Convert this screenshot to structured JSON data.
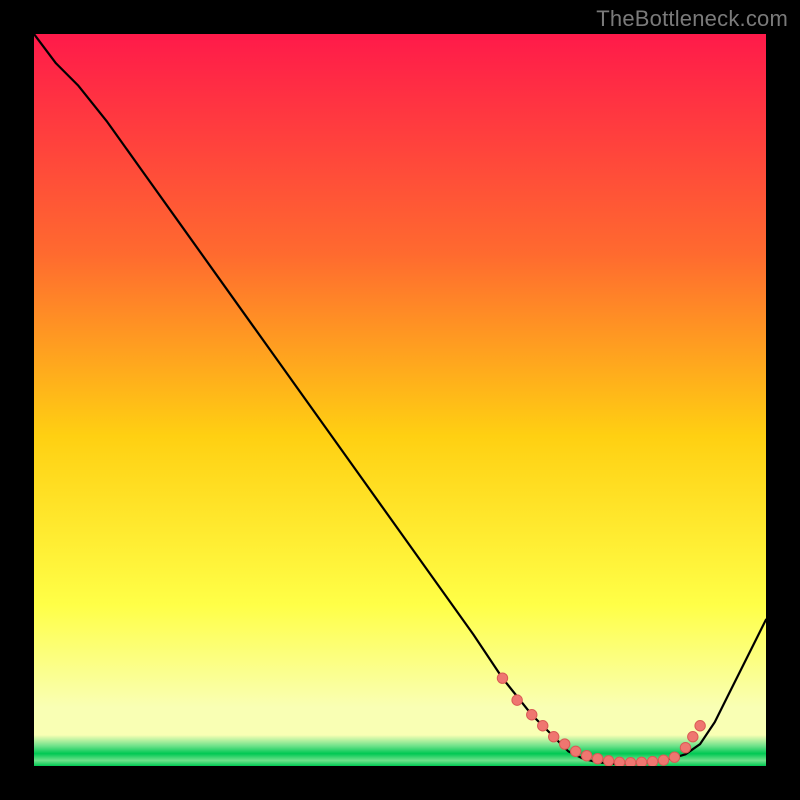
{
  "watermark": "TheBottleneck.com",
  "colors": {
    "black": "#000000",
    "watermark_text": "#7a7a7a",
    "curve_stroke": "#000000",
    "marker_fill": "#ef7670",
    "marker_stroke": "#d95a55",
    "gradient_top": "#ff1a4a",
    "gradient_mid_upper": "#ff6a2f",
    "gradient_mid": "#ffd012",
    "gradient_lower": "#ffff47",
    "gradient_pale": "#f9ffb4",
    "green_mid": "#6fe28b",
    "green_deep": "#00c853"
  },
  "chart_data": {
    "type": "line",
    "title": "",
    "xlabel": "",
    "ylabel": "",
    "xlim": [
      0,
      100
    ],
    "ylim": [
      0,
      100
    ],
    "grid": false,
    "legend": false,
    "series": [
      {
        "name": "bottleneck-curve",
        "x": [
          0,
          3,
          6,
          10,
          15,
          20,
          25,
          30,
          35,
          40,
          45,
          50,
          55,
          60,
          64,
          68,
          71,
          73,
          75,
          77,
          79,
          81,
          83,
          85,
          87,
          89,
          91,
          93,
          95,
          97,
          100
        ],
        "y": [
          100,
          96,
          93,
          88,
          81,
          74,
          67,
          60,
          53,
          46,
          39,
          32,
          25,
          18,
          12,
          7,
          4,
          2,
          1,
          0.5,
          0.3,
          0.3,
          0.4,
          0.6,
          1,
          1.6,
          3,
          6,
          10,
          14,
          20
        ]
      }
    ],
    "markers": {
      "name": "highlight-points",
      "points": [
        {
          "x": 64,
          "y": 12
        },
        {
          "x": 66,
          "y": 9
        },
        {
          "x": 68,
          "y": 7
        },
        {
          "x": 69.5,
          "y": 5.5
        },
        {
          "x": 71,
          "y": 4
        },
        {
          "x": 72.5,
          "y": 3
        },
        {
          "x": 74,
          "y": 2
        },
        {
          "x": 75.5,
          "y": 1.4
        },
        {
          "x": 77,
          "y": 1
        },
        {
          "x": 78.5,
          "y": 0.7
        },
        {
          "x": 80,
          "y": 0.5
        },
        {
          "x": 81.5,
          "y": 0.45
        },
        {
          "x": 83,
          "y": 0.5
        },
        {
          "x": 84.5,
          "y": 0.6
        },
        {
          "x": 86,
          "y": 0.8
        },
        {
          "x": 87.5,
          "y": 1.2
        },
        {
          "x": 89,
          "y": 2.5
        },
        {
          "x": 90,
          "y": 4
        },
        {
          "x": 91,
          "y": 5.5
        }
      ]
    },
    "background": {
      "description": "vertical rainbow gradient red→orange→yellow→pale→green, heavy green concentration in bottom ~4% of plot height"
    }
  }
}
